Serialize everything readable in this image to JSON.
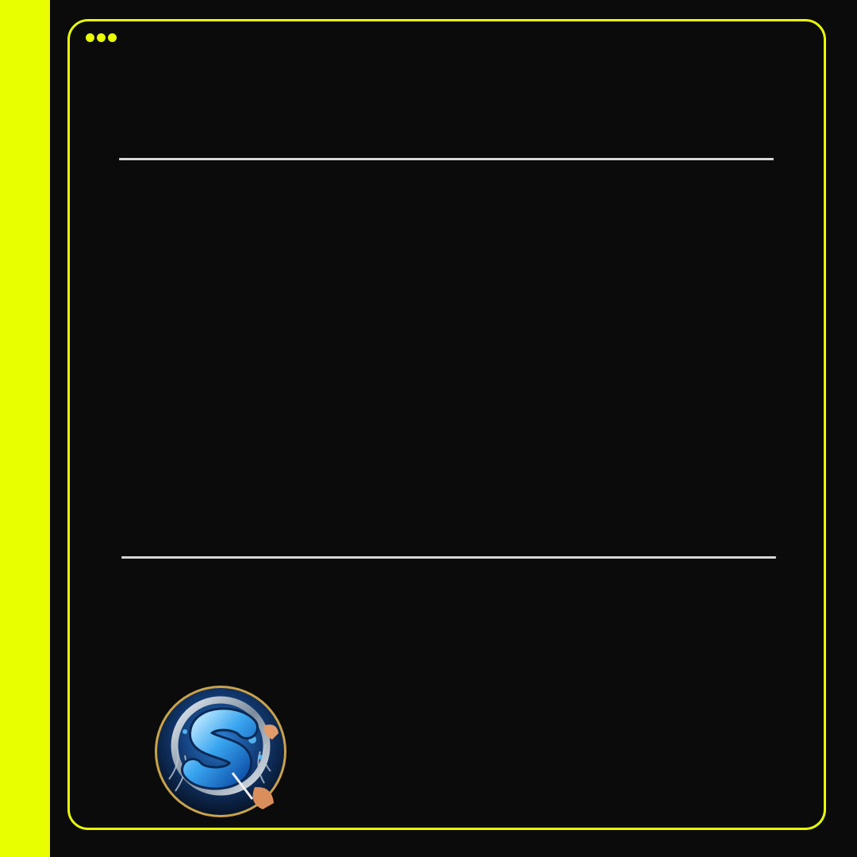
{
  "colors": {
    "accent": "#e8ff00",
    "background": "#0b0b0b",
    "divider": "#d6d6d6"
  },
  "window_controls": {
    "icon": "more-dots-icon"
  },
  "logo": {
    "icon": "brand-s-logo-icon",
    "letter": "S"
  }
}
